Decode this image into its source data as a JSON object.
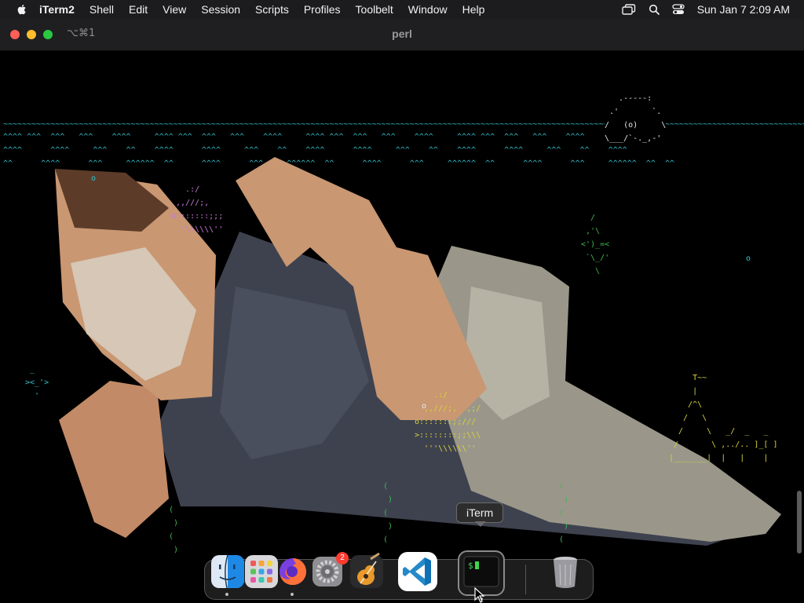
{
  "menubar": {
    "app_name": "iTerm2",
    "items": [
      "Shell",
      "Edit",
      "View",
      "Session",
      "Scripts",
      "Profiles",
      "Toolbelt",
      "Window",
      "Help"
    ],
    "status_icons": [
      "screen-mirroring-icon",
      "search-icon",
      "control-center-icon"
    ],
    "clock": "Sun Jan 7  2:09 AM"
  },
  "window": {
    "shortcut": "⌥⌘1",
    "title": "perl"
  },
  "terminal": {
    "scene": {
      "waves": "~~~~~~~~~~~~~~~~~~~~~~~~~~~~~~~~~~~~~~~~~~~~~~~~~~~~~~~~~~~~~~~~~~~~~~~~~~~~~~~~~~~~~~~~~~~~~~~~~~~~~~~~~~~~~~~~~~~~~~~~~~~~~~~~~~~~~~~~~~~~~~~~~~~~~~~~~~~~~~~~~~~~~~~~~~~~~~~~~~~~~~~~~~~~~~~~",
      "ripple_a": "^^^^ ^^^  ^^^   ^^^    ^^^^     ^^^^ ^^^  ^^^   ^^^    ^^^^     ^^^^ ^^^  ^^^   ^^^    ^^^^     ^^^^ ^^^  ^^^   ^^^    ^^^^     ^^^^ ^^^",
      "ripple_b": "^^^^      ^^^^     ^^^    ^^    ^^^^      ^^^^     ^^^    ^^    ^^^^      ^^^^     ^^^    ^^    ^^^^      ^^^^     ^^^    ^^    ^^^^",
      "ripple_c": "^^      ^^^^      ^^^     ^^^^^^  ^^      ^^^^      ^^^     ^^^^^^  ^^      ^^^^      ^^^     ^^^^^^  ^^      ^^^^      ^^^     ^^^^^^  ^^  ^^",
      "whale": "   .-----:\n .'       `.\n/   (o)     \\\n\\___/`-._,-'",
      "fish_1": "   .:/\n ,,///;,\no:::::::;;;\n  '\\\\\\\\\\\\''",
      "fish_2": "    .:/\n  ,,///;,  ,;/\no:::::::;;///\n>::::::::;;\\\\\\\n  '''\\\\\\\\\\\\'' ",
      "seahorse_1": "  /\n ,'\\\n<')_=<\n `\\_/'\n   \\",
      "seahorse_2": " _\n><_'>\n  '",
      "seaweed": "(\n )\n(\n )\n(",
      "castle": "     T~~\n     |\n    /^\\\n   /   \\\n  /     \\   _/  _   _\n /       \\ ,../.. ]_[ ]\n|_______|  |   |    |",
      "bubbles": [
        "o",
        "o",
        "o"
      ]
    }
  },
  "dock": {
    "apps": [
      {
        "name": "Finder",
        "running": true
      },
      {
        "name": "Launchpad",
        "running": false
      },
      {
        "name": "Firefox",
        "running": true
      },
      {
        "name": "System Settings",
        "running": false,
        "badge": "2"
      },
      {
        "name": "GarageBand",
        "running": false
      },
      {
        "name": "Visual Studio Code",
        "running": false
      },
      {
        "name": "iTerm",
        "running": true
      },
      {
        "name": "Trash",
        "running": false
      }
    ],
    "tooltip": "iTerm"
  },
  "colors": {
    "menubar_bg": "#1c1c1e",
    "titlebar_bg": "#1f1f21",
    "ascii_cyan": "#33c3cf",
    "ascii_yellow": "#d9d23a",
    "ascii_green": "#3fb950",
    "skin": "#c99772",
    "shirt": "#3e424f",
    "sleeve": "#9a978a"
  }
}
